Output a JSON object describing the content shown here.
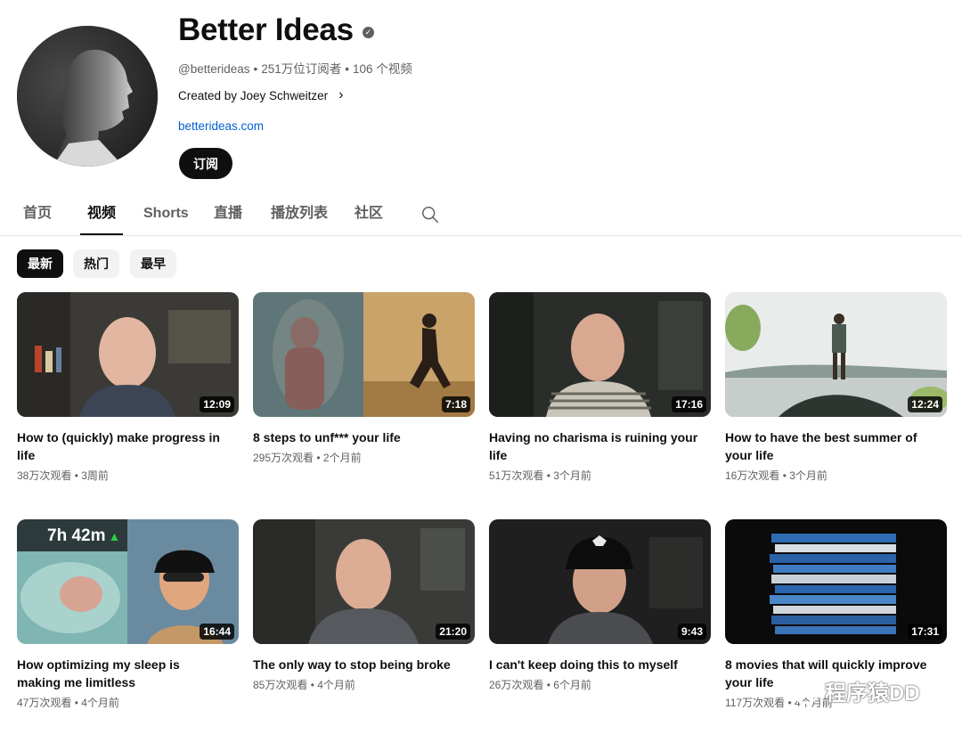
{
  "channel": {
    "name": "Better Ideas",
    "handle": "@betterideas",
    "subscribers": "251万位订阅者",
    "video_count": "106 个视频",
    "created_by": "Created by Joey Schweitzer",
    "website": "betterideas.com",
    "subscribe_label": "订阅",
    "verified_icon": "verified-check-icon"
  },
  "tabs": [
    {
      "label": "首页",
      "active": false
    },
    {
      "label": "视频",
      "active": true
    },
    {
      "label": "Shorts",
      "active": false
    },
    {
      "label": "直播",
      "active": false
    },
    {
      "label": "播放列表",
      "active": false
    },
    {
      "label": "社区",
      "active": false
    }
  ],
  "search_icon": "search-icon",
  "filters": [
    {
      "label": "最新",
      "active": true
    },
    {
      "label": "热门",
      "active": false
    },
    {
      "label": "最早",
      "active": false
    }
  ],
  "videos": [
    {
      "title": "How to (quickly) make progress in life",
      "duration": "12:09",
      "views": "38万次观看",
      "age": "3周前"
    },
    {
      "title": "8 steps to unf*** your life",
      "duration": "7:18",
      "views": "295万次观看",
      "age": "2个月前"
    },
    {
      "title": "Having no charisma is ruining your life",
      "duration": "17:16",
      "views": "51万次观看",
      "age": "3个月前"
    },
    {
      "title": "How to have the best summer of your life",
      "duration": "12:24",
      "views": "16万次观看",
      "age": "3个月前"
    },
    {
      "title": "How optimizing my sleep is making me limitless",
      "duration": "16:44",
      "views": "47万次观看",
      "age": "4个月前",
      "overlay_text": "7h 42m"
    },
    {
      "title": "The only way to stop being broke",
      "duration": "21:20",
      "views": "85万次观看",
      "age": "4个月前"
    },
    {
      "title": "I can't keep doing this to myself",
      "duration": "9:43",
      "views": "26万次观看",
      "age": "6个月前"
    },
    {
      "title": "8 movies that will quickly improve your life",
      "duration": "17:31",
      "views": "117万次观看",
      "age": "4个月前"
    }
  ],
  "meta_separator": "•",
  "watermark": "程序猿DD",
  "colors": {
    "link": "#065fd4",
    "text": "#0f0f0f",
    "secondary": "#606060",
    "chip_bg": "#f2f2f2"
  }
}
